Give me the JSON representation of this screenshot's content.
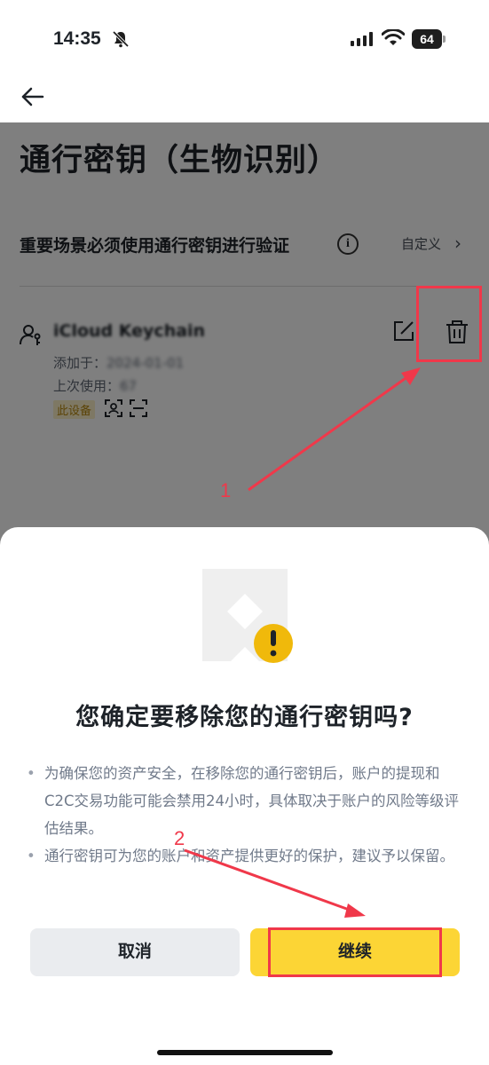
{
  "status_bar": {
    "time": "14:35",
    "battery": "64",
    "icons": [
      "bell-slash-icon",
      "signal-icon",
      "wifi-icon",
      "battery-icon"
    ]
  },
  "header": {
    "back_icon": "arrow-left-icon"
  },
  "page": {
    "title": "通行密钥（生物识别）",
    "verify_row": {
      "text": "重要场景必须使用通行密钥进行验证",
      "info_icon": "i",
      "custom_label": "自定义",
      "chevron": "›"
    },
    "passkey": {
      "name": "iCloud Keychain",
      "added_label": "添加于：",
      "added_value": "2024-01-01",
      "last_used_label": "上次使用：",
      "last_used_value": "67",
      "badge": "此设备",
      "icons": [
        "user-key-icon",
        "scan-icon",
        "scan-frame-icon",
        "edit-icon",
        "trash-icon"
      ]
    }
  },
  "annotations": {
    "step1": "1",
    "step2": "2",
    "color": "#f0384a"
  },
  "dialog": {
    "title": "您确定要移除您的通行密钥吗?",
    "bullet_mark": "•",
    "bullets": [
      "为确保您的资产安全，在移除您的通行密钥后，账户的提现和C2C交易功能可能会禁用24小时，具体取决于账户的风险等级评估结果。",
      "通行密钥可为您的账户和资产提供更好的保护，建议予以保留。"
    ],
    "cancel_label": "取消",
    "continue_label": "继续",
    "accent": "#fcd535",
    "warning_color": "#f0b90b"
  }
}
